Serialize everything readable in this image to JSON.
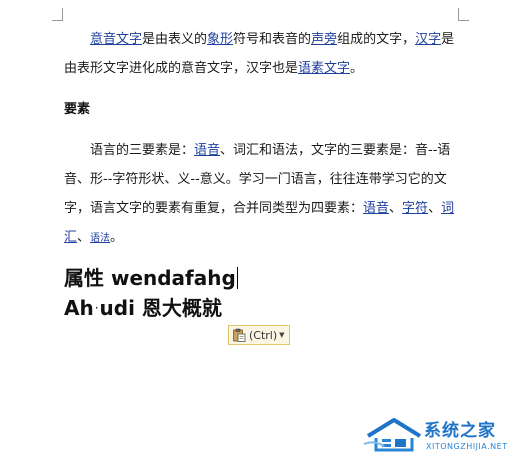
{
  "document": {
    "paragraph1": {
      "link_ideographic": "意音文字",
      "text1": "是由表义的",
      "link_pictograph": "象形",
      "text2": "符号和表音的",
      "link_phonetic": "声旁",
      "text3": "组成的文字，",
      "link_hanzi": "汉字",
      "text4": "是由表形文字进化成的意音文字，汉字也是",
      "link_morpheme_script": "语素文字",
      "text5": "。"
    },
    "heading": "要素",
    "paragraph2": {
      "text1": "语言的三要素是：",
      "link_phonetics": "语音",
      "text2": "、词汇和语法，文字的三要素是：音--语音、形--字符形状、义--意义。学习一门语言，往往连带学习它的文字，语言文字的要素有重复，合并同类型为四要素：",
      "link_phonetics2": "语音",
      "sep1": "、",
      "link_character": "字符",
      "sep2": "、",
      "link_vocabulary": "词汇",
      "sep3": "、",
      "link_grammar": "语法",
      "end": "。"
    },
    "typed_line1": "属性 wendafahg",
    "typed_line2_a": "Ah",
    "typed_line2_dot": "·",
    "typed_line2_b": "udi 恩大概就"
  },
  "paste_options": {
    "label": "(Ctrl)",
    "icon": "clipboard-icon",
    "arrow": "▼"
  },
  "watermark": {
    "title": "系统之家",
    "subtitle": "XITONGZHIJIA.NET",
    "color": "#1f74c7"
  },
  "colors": {
    "link": "#1f3f9e",
    "paste_border": "#e2c56a",
    "paste_bg": "#fbf6e3"
  }
}
